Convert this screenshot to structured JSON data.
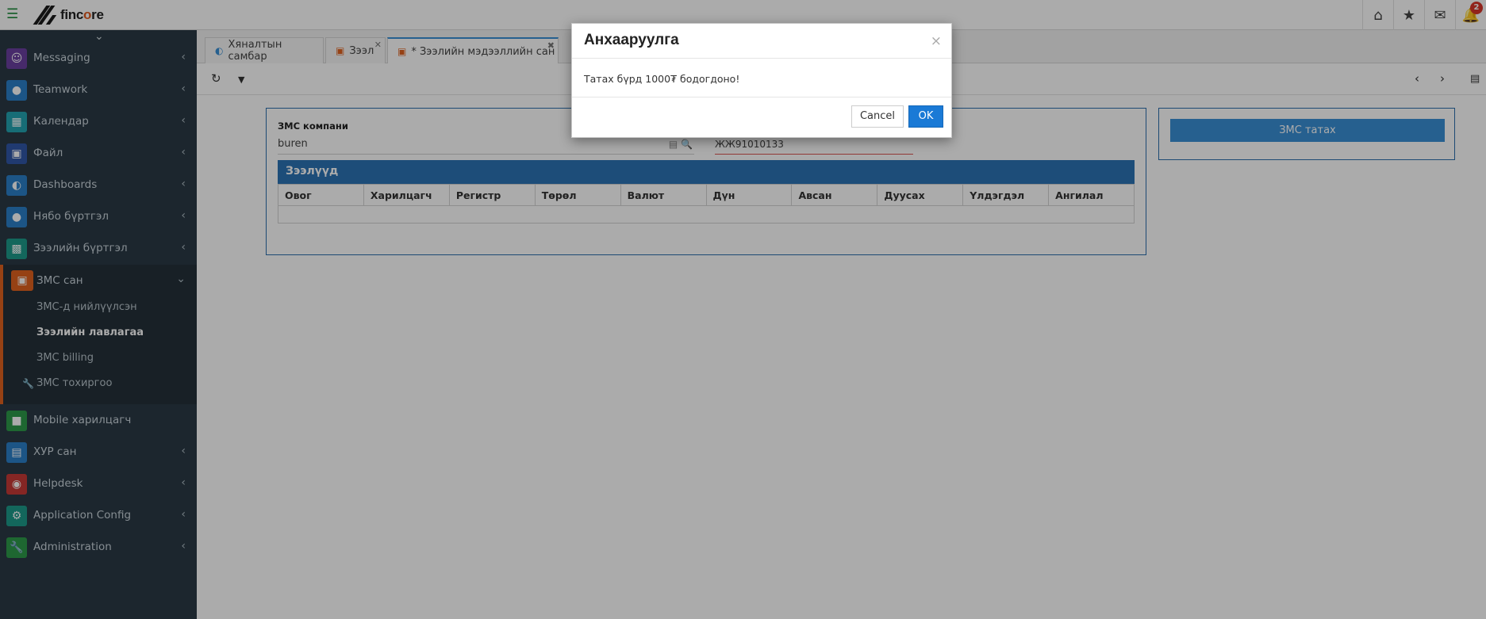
{
  "header": {
    "brand": "fincore",
    "menu_icon": "hamburger-icon",
    "icons": [
      "home-icon",
      "star-icon",
      "mail-icon",
      "bell-icon"
    ],
    "notification_count": "2"
  },
  "sidebar": {
    "items": [
      {
        "label": "Messaging",
        "icon": "users-icon",
        "color": "#6b3fa0"
      },
      {
        "label": "Teamwork",
        "icon": "user-icon",
        "color": "#2a7fc8"
      },
      {
        "label": "Календар",
        "icon": "calendar-icon",
        "color": "#23a3b0"
      },
      {
        "label": "Файл",
        "icon": "archive-icon",
        "color": "#3057a8"
      },
      {
        "label": "Dashboards",
        "icon": "dashboard-icon",
        "color": "#2a7fc8"
      },
      {
        "label": "Нябо бүртгэл",
        "icon": "user-icon",
        "color": "#2a7fc8"
      },
      {
        "label": "Зээлийн бүртгэл",
        "icon": "money-icon",
        "color": "#1d9a8a"
      }
    ],
    "open_group": {
      "label": "ЗМС сан",
      "icon": "archive-icon",
      "subitems": [
        {
          "label": "ЗМС-д нийлүүлсэн",
          "active": false
        },
        {
          "label": "Зээлийн лавлагаа",
          "active": true
        },
        {
          "label": "ЗМС billing",
          "active": false
        },
        {
          "label": "ЗМС тохиргоо",
          "active": false
        }
      ]
    },
    "items_after": [
      {
        "label": "Mobile харилцагч",
        "icon": "mobile-icon",
        "color": "#2e9a4a",
        "arrow": false
      },
      {
        "label": "ХУР сан",
        "icon": "id-card-icon",
        "color": "#2a7fc8",
        "arrow": true
      },
      {
        "label": "Helpdesk",
        "icon": "lifebuoy-icon",
        "color": "#c63a36",
        "arrow": true
      },
      {
        "label": "Application Config",
        "icon": "gear-icon",
        "color": "#1d9a8a",
        "arrow": true
      },
      {
        "label": "Administration",
        "icon": "wrench-icon",
        "color": "#2e9a4a",
        "arrow": true
      }
    ]
  },
  "tabs": [
    {
      "label": "Хяналтын самбар"
    },
    {
      "label": "Зээл"
    },
    {
      "label": "* Зээлийн мэдээллийн сан"
    }
  ],
  "form": {
    "company_label": "ЗМС компани",
    "company_value": "buren",
    "register_value": "ЖЖ91010133",
    "grid_title": "Зээлүүд",
    "columns": [
      "Овог",
      "Харилцагч",
      "Регистр",
      "Төрөл",
      "Валют",
      "Дүн",
      "Авсан",
      "Дуусах",
      "Үлдэгдэл",
      "Ангилал"
    ],
    "side_button": "ЗМС татах"
  },
  "modal": {
    "title": "Анхааруулга",
    "message": "Татах бүрд 1000₮ бодогдоно!",
    "cancel": "Cancel",
    "ok": "OK"
  }
}
